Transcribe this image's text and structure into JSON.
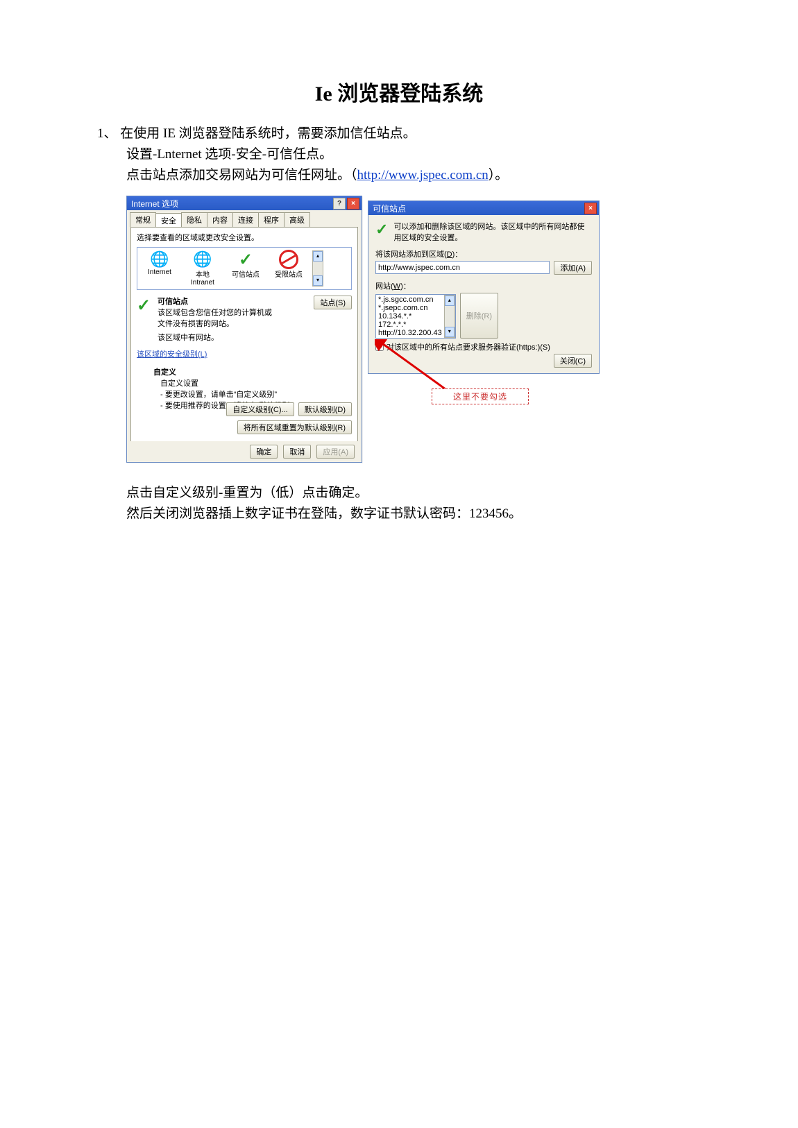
{
  "doc": {
    "title": "Ie 浏览器登陆系统",
    "lines": {
      "l1": "1、 在使用 IE 浏览器登陆系统时，需要添加信任站点。",
      "l2": "设置-Lnternet 选项-安全-可信任点。",
      "l3_pre": "点击站点添加交易网站为可信任网址。（",
      "l3_url": "http://www.jspec.com.cn",
      "l3_post": "）。",
      "l4": "点击自定义级别-重置为（低）点击确定。",
      "l5": "然后关闭浏览器插上数字证书在登陆，数字证书默认密码：123456。"
    }
  },
  "dlg1": {
    "title": "Internet 选项",
    "help_btn": "?",
    "close_btn": "×",
    "tabs": {
      "t0": "常规",
      "t1": "安全",
      "t2": "隐私",
      "t3": "内容",
      "t4": "连接",
      "t5": "程序",
      "t6": "高级"
    },
    "zone_prompt": "选择要查看的区域或更改安全设置。",
    "zones": {
      "internet": "Internet",
      "intranet": "本地\nIntranet",
      "trusted": "可信站点",
      "restricted": "受限站点"
    },
    "trusted": {
      "title": "可信站点",
      "desc": "该区域包含您信任对您的计算机或\n文件没有损害的网站。",
      "note": "该区域中有网站。"
    },
    "sites_btn": "站点(S)",
    "sec_level_link": "该区域的安全级别(L)",
    "custom": {
      "head": "自定义",
      "l1": "自定义设置",
      "l2": "- 要更改设置，请单击“自定义级别”",
      "l3": "- 要使用推荐的设置，请单击“默认级别”"
    },
    "btns": {
      "custom": "自定义级别(C)...",
      "default": "默认级别(D)",
      "reset": "将所有区域重置为默认级别(R)",
      "ok": "确定",
      "cancel": "取消",
      "apply": "应用(A)"
    }
  },
  "dlg2": {
    "title": "可信站点",
    "close_btn": "×",
    "intro": "可以添加和删除该区域的网站。该区域中的所有网站都使用区域的安全设置。",
    "addlabel": "将该网站添加到区域(D)：",
    "url_value": "http://www.jspec.com.cn",
    "add_btn": "添加(A)",
    "listlabel": "网站(W)：",
    "sites": {
      "s0": "*.js.sgcc.com.cn",
      "s1": "*.jsepc.com.cn",
      "s2": "10.134.*.*",
      "s3": "172.*.*.*",
      "s4": "http://10.32.200.43"
    },
    "remove_btn": "删除(R)",
    "cb_label": "对该区域中的所有站点要求服务器验证(https:)(S)",
    "close2": "关闭(C)"
  },
  "annotation": {
    "text": "这里不要勾选"
  }
}
